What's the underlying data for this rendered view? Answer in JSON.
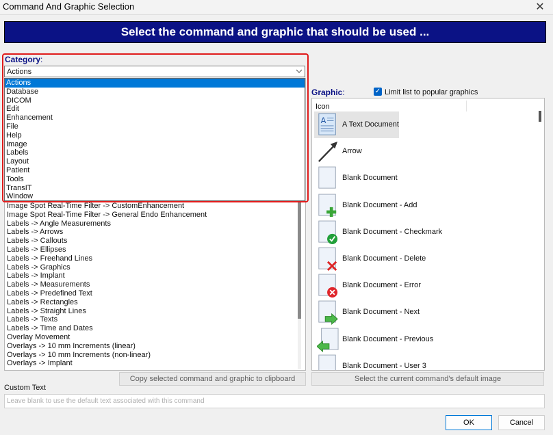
{
  "window": {
    "title": "Command And Graphic Selection",
    "close_glyph": "✕"
  },
  "banner": {
    "text": "Select the command and graphic that should be used ..."
  },
  "category": {
    "label": "Category",
    "colon": ":",
    "selected": "Actions",
    "options": [
      "Actions",
      "Database",
      "DICOM",
      "Edit",
      "Enhancement",
      "File",
      "Help",
      "Image",
      "Labels",
      "Layout",
      "Patient",
      "Tools",
      "TransIT",
      "Window"
    ]
  },
  "commands": {
    "items": [
      "Image Spot Real-Time Filter -> CustomEnhancement",
      "Image Spot Real-Time Filter -> General Endo Enhancement",
      "Labels -> Angle Measurements",
      "Labels -> Arrows",
      "Labels -> Callouts",
      "Labels -> Ellipses",
      "Labels -> Freehand Lines",
      "Labels -> Graphics",
      "Labels -> Implant",
      "Labels -> Measurements",
      "Labels -> Predefined Text",
      "Labels -> Rectangles",
      "Labels -> Straight Lines",
      "Labels -> Texts",
      "Labels -> Time and Dates",
      "Overlay Movement",
      "Overlays -> 10 mm Increments (linear)",
      "Overlays -> 10 mm Increments (non-linear)",
      "Overlays -> Implant"
    ]
  },
  "buttons": {
    "copy": "Copy selected command and graphic to clipboard",
    "default_image": "Select the current command's default image",
    "ok": "OK",
    "cancel": "Cancel"
  },
  "graphic": {
    "label": "Graphic",
    "colon": ":",
    "limit_label": "Limit list to popular graphics",
    "limit_checked": true,
    "column_header": "Icon",
    "items": [
      {
        "label": "A Text Document",
        "icon": "text-document-icon"
      },
      {
        "label": "Arrow",
        "icon": "arrow-icon"
      },
      {
        "label": "Blank Document",
        "icon": "blank-document-icon"
      },
      {
        "label": "Blank Document - Add",
        "icon": "blank-document-add-icon"
      },
      {
        "label": "Blank Document - Checkmark",
        "icon": "blank-document-checkmark-icon"
      },
      {
        "label": "Blank Document - Delete",
        "icon": "blank-document-delete-icon"
      },
      {
        "label": "Blank Document - Error",
        "icon": "blank-document-error-icon"
      },
      {
        "label": "Blank Document - Next",
        "icon": "blank-document-next-icon"
      },
      {
        "label": "Blank Document - Previous",
        "icon": "blank-document-previous-icon"
      },
      {
        "label": "Blank Document - User 3",
        "icon": "blank-document-user-icon"
      }
    ]
  },
  "custom_text": {
    "label": "Custom Text",
    "placeholder": "Leave blank to use the default text associated with this command"
  },
  "colors": {
    "banner": "#0b1285",
    "highlight": "#e01b1b",
    "selection": "#0078d7",
    "label_blue": "#0b1285"
  }
}
